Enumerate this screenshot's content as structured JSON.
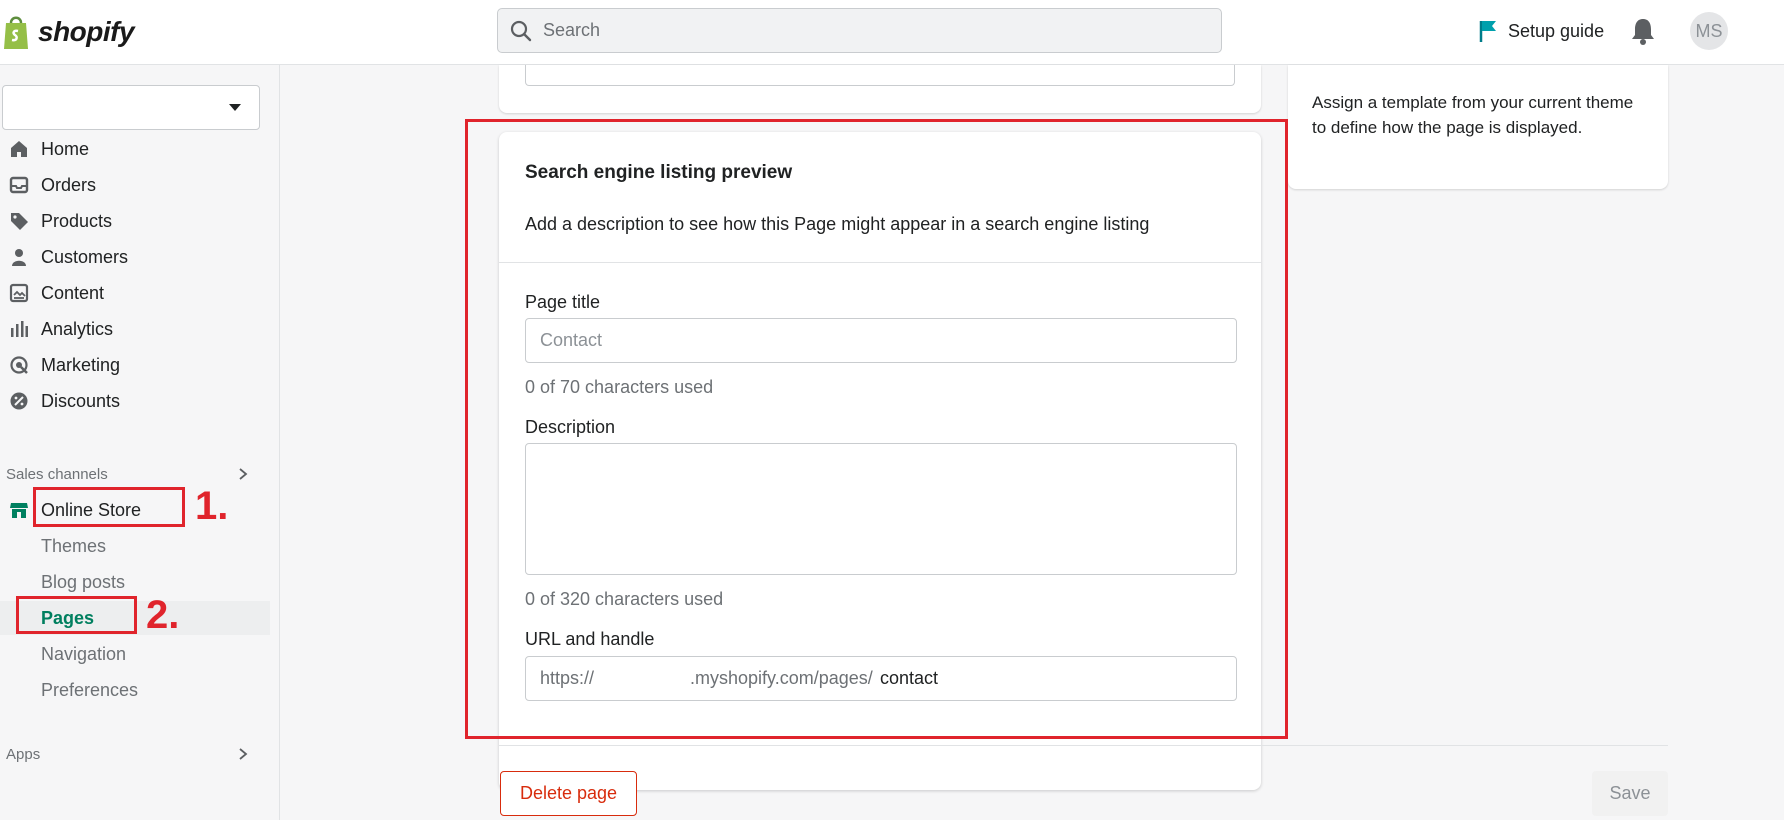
{
  "brand": {
    "name": "shopify",
    "color": "#95bf47"
  },
  "topbar": {
    "search_placeholder": "Search",
    "setup_guide": "Setup guide",
    "avatar_initials": "MS"
  },
  "sidebar": {
    "nav": [
      {
        "label": "Home",
        "icon": "home-icon"
      },
      {
        "label": "Orders",
        "icon": "inbox-icon"
      },
      {
        "label": "Products",
        "icon": "tag-icon"
      },
      {
        "label": "Customers",
        "icon": "person-icon"
      },
      {
        "label": "Content",
        "icon": "image-icon"
      },
      {
        "label": "Analytics",
        "icon": "bar-chart-icon"
      },
      {
        "label": "Marketing",
        "icon": "target-icon"
      },
      {
        "label": "Discounts",
        "icon": "discount-icon"
      }
    ],
    "sales_channels_label": "Sales channels",
    "online_store": "Online Store",
    "online_store_sub": [
      "Themes",
      "Blog posts",
      "Pages",
      "Navigation",
      "Preferences"
    ],
    "active_sub": "Pages",
    "apps_label": "Apps"
  },
  "main": {
    "template_help": "Assign a template from your current theme to define how the page is displayed.",
    "seo": {
      "title": "Search engine listing preview",
      "description": "Add a description to see how this Page might appear in a search engine listing",
      "page_title_label": "Page title",
      "page_title_placeholder": "Contact",
      "page_title_help": "0 of 70 characters used",
      "description_label": "Description",
      "description_help": "0 of 320 characters used",
      "url_label": "URL and handle",
      "url_prefix": "https://",
      "url_suffix": ".myshopify.com/pages/",
      "url_handle": "contact"
    },
    "delete_label": "Delete page",
    "save_label": "Save"
  },
  "annotations": {
    "step1": "1.",
    "step2": "2.",
    "color": "#e0242c"
  }
}
